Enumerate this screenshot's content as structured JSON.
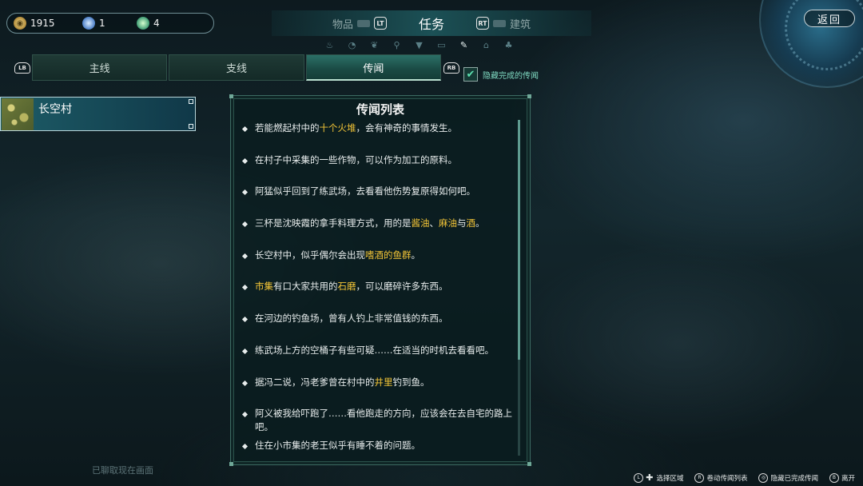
{
  "currency": [
    {
      "icon": "coin-icon",
      "value": "1915"
    },
    {
      "icon": "gem-icon",
      "value": "1"
    },
    {
      "icon": "leaf-icon",
      "value": "4"
    }
  ],
  "top_tabs": {
    "left": {
      "label": "物品",
      "button": "LT"
    },
    "active": "任务",
    "right": {
      "label": "建筑",
      "button": "RT"
    }
  },
  "back_label": "返回",
  "sub_tabs": {
    "left_button": "LB",
    "right_button": "RB",
    "items": [
      "主线",
      "支线",
      "传闻"
    ],
    "active_index": 2
  },
  "hide_completed": {
    "label": "隐藏完成的传闻",
    "checked": true
  },
  "location": {
    "name": "长空村"
  },
  "panel_title": "传闻列表",
  "rumors": [
    [
      {
        "t": "若能燃起村中的"
      },
      {
        "t": "十个火堆",
        "hl": true
      },
      {
        "t": "，会有神奇的事情发生。"
      }
    ],
    [
      {
        "t": "在村子中采集的一些作物，可以作为加工的原料。"
      }
    ],
    [
      {
        "t": "阿猛似乎回到了练武场，去看看他伤势复原得如何吧。"
      }
    ],
    [
      {
        "t": "三杯是沈映霞的拿手料理方式，用的是"
      },
      {
        "t": "酱油",
        "hl": true
      },
      {
        "t": "、"
      },
      {
        "t": "麻油",
        "hl": true
      },
      {
        "t": "与"
      },
      {
        "t": "酒",
        "hl": true
      },
      {
        "t": "。"
      }
    ],
    [
      {
        "t": "长空村中，似乎偶尔会出现"
      },
      {
        "t": "嗜酒的鱼群",
        "hl": true
      },
      {
        "t": "。"
      }
    ],
    [
      {
        "t": "市集",
        "hl": true
      },
      {
        "t": "有口大家共用的"
      },
      {
        "t": "石磨",
        "hl": true
      },
      {
        "t": "，可以磨碎许多东西。"
      }
    ],
    [
      {
        "t": "在河边的钓鱼场，曾有人钓上非常值钱的东西。"
      }
    ],
    [
      {
        "t": "练武场上方的空桶子有些可疑……在适当的时机去看看吧。"
      }
    ],
    [
      {
        "t": "据冯二说，冯老爹曾在村中的"
      },
      {
        "t": "井里",
        "hl": true
      },
      {
        "t": "钓到鱼。"
      }
    ],
    [
      {
        "t": "阿义被我给吓跑了……看他跑走的方向，应该会在去自宅的路上吧。"
      }
    ],
    [
      {
        "t": "住在小市集的老王似乎有睡不着的问题。"
      }
    ]
  ],
  "footer_note": "已聊取现在画面",
  "hints": [
    {
      "button": "L",
      "label": "选择区域"
    },
    {
      "button": "R",
      "label": "卷动传闻列表"
    },
    {
      "button": "◎",
      "label": "隐藏已完成传闻"
    },
    {
      "button": "B",
      "label": "离开"
    }
  ],
  "colors": {
    "highlight": "#f2c437",
    "accent": "#2b6f66",
    "check": "#5ce0b0"
  }
}
